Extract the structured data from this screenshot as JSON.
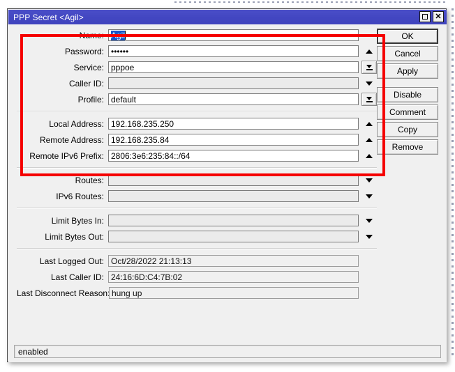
{
  "window": {
    "title": "PPP Secret <Agil>",
    "title_bar_color": "#4347c2",
    "maximize_icon": "maximize-icon",
    "close_icon": "close-icon",
    "close_glyph": "✕"
  },
  "annotation": {
    "color": "#f50000",
    "shape": "rectangle"
  },
  "form": {
    "groups": [
      {
        "rows": [
          {
            "label": "Name:",
            "value": "Agil",
            "selected": true,
            "state": "enabled",
            "control": "none"
          },
          {
            "label": "Password:",
            "value": "••••••",
            "state": "enabled",
            "control": "up-triangle"
          },
          {
            "label": "Service:",
            "value": "pppoe",
            "state": "enabled",
            "control": "dropdown-boxed"
          },
          {
            "label": "Caller ID:",
            "value": "",
            "state": "disabled",
            "control": "down-triangle"
          },
          {
            "label": "Profile:",
            "value": "default",
            "state": "enabled",
            "control": "dropdown-boxed"
          }
        ]
      },
      {
        "rows": [
          {
            "label": "Local Address:",
            "value": "192.168.235.250",
            "state": "enabled",
            "control": "up-triangle"
          },
          {
            "label": "Remote Address:",
            "value": "192.168.235.84",
            "state": "enabled",
            "control": "up-triangle"
          },
          {
            "label": "Remote IPv6 Prefix:",
            "value": "2806:3e6:235:84::/64",
            "state": "enabled",
            "control": "up-triangle"
          }
        ]
      },
      {
        "rows": [
          {
            "label": "Routes:",
            "value": "",
            "state": "disabled",
            "control": "down-triangle"
          },
          {
            "label": "IPv6 Routes:",
            "value": "",
            "state": "disabled",
            "control": "down-triangle"
          }
        ]
      },
      {
        "rows": [
          {
            "label": "Limit Bytes In:",
            "value": "",
            "state": "disabled",
            "control": "down-triangle"
          },
          {
            "label": "Limit Bytes Out:",
            "value": "",
            "state": "disabled",
            "control": "down-triangle"
          }
        ]
      },
      {
        "rows": [
          {
            "label": "Last Logged Out:",
            "value": "Oct/28/2022 21:13:13",
            "state": "readonly",
            "control": "none"
          },
          {
            "label": "Last Caller ID:",
            "value": "24:16:6D:C4:7B:02",
            "state": "readonly",
            "control": "none"
          },
          {
            "label": "Last Disconnect Reason:",
            "value": "hung up",
            "state": "readonly",
            "control": "none"
          }
        ]
      }
    ]
  },
  "buttons": [
    {
      "label": "OK",
      "default": true
    },
    {
      "label": "Cancel",
      "default": false
    },
    {
      "label": "Apply",
      "default": false
    },
    {
      "label": "Disable",
      "default": false,
      "spacer_before": true
    },
    {
      "label": "Comment",
      "default": false
    },
    {
      "label": "Copy",
      "default": false
    },
    {
      "label": "Remove",
      "default": false
    }
  ],
  "statusbar": {
    "text": "enabled"
  }
}
